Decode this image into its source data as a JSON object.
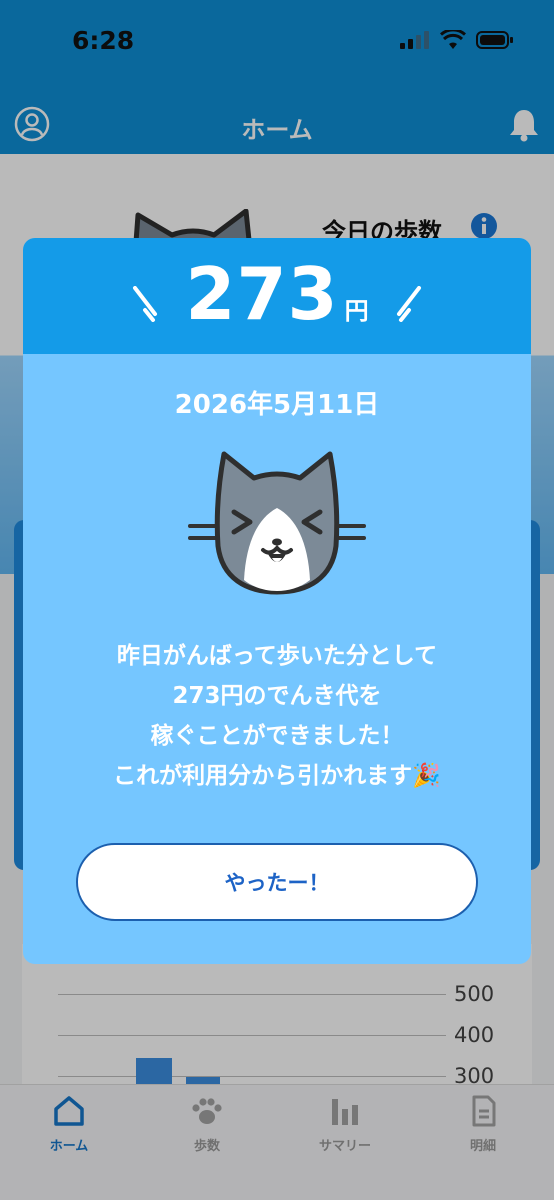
{
  "status": {
    "time": "6:28"
  },
  "header": {
    "title": "ホーム"
  },
  "home": {
    "steps_title": "今日の歩数",
    "chart": {
      "ticks": [
        "500",
        "400",
        "300"
      ]
    }
  },
  "modal": {
    "amount": "273",
    "amount_unit": "円",
    "date": "2026年5月11日",
    "message_lines": [
      "昨日がんばって歩いた分として",
      "273円のでんき代を",
      "稼ぐことができました！",
      "これが利用分から引かれます🎉"
    ],
    "button_label": "やったー！"
  },
  "tabs": [
    {
      "label": "ホーム",
      "icon": "home-icon",
      "active": true
    },
    {
      "label": "歩数",
      "icon": "paw-icon",
      "active": false
    },
    {
      "label": "サマリー",
      "icon": "bar-chart-icon",
      "active": false
    },
    {
      "label": "明細",
      "icon": "document-icon",
      "active": false
    }
  ],
  "colors": {
    "brand_blue": "#0f8fd6",
    "modal_header": "#149be8",
    "modal_body": "#75c6ff",
    "button_text": "#1d63c6"
  }
}
